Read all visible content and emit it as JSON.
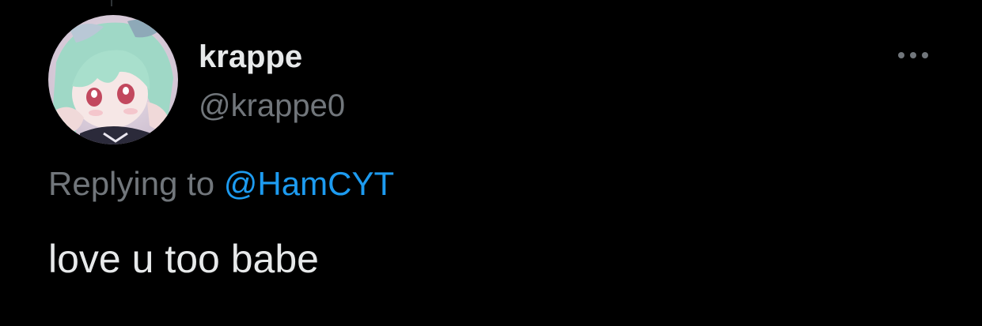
{
  "tweet": {
    "author": {
      "display_name": "krappe",
      "handle": "@krappe0",
      "avatar_icon": "anime-avatar-icon"
    },
    "reply_prefix": "Replying to ",
    "reply_mention": "@HamCYT",
    "text": "love u too babe",
    "more_icon": "more-horizontal-icon"
  },
  "colors": {
    "background": "#000000",
    "primary_text": "#e7e9ea",
    "secondary_text": "#71767b",
    "link": "#1d9bf0"
  }
}
